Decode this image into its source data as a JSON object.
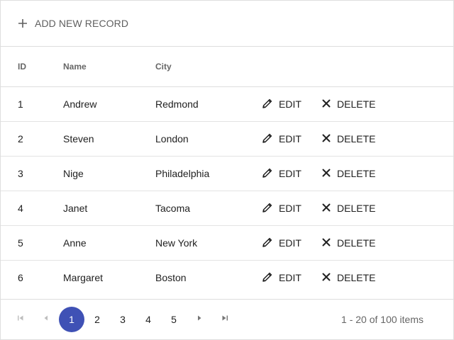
{
  "toolbar": {
    "add_icon": "plus-icon",
    "add_label": "ADD NEW RECORD"
  },
  "columns": [
    "ID",
    "Name",
    "City"
  ],
  "rows": [
    {
      "id": "1",
      "name": "Andrew",
      "city": "Redmond"
    },
    {
      "id": "2",
      "name": "Steven",
      "city": "London"
    },
    {
      "id": "3",
      "name": "Nige",
      "city": "Philadelphia"
    },
    {
      "id": "4",
      "name": "Janet",
      "city": "Tacoma"
    },
    {
      "id": "5",
      "name": "Anne",
      "city": "New York"
    },
    {
      "id": "6",
      "name": "Margaret",
      "city": "Boston"
    }
  ],
  "actions": {
    "edit_label": "EDIT",
    "edit_icon": "pencil-icon",
    "delete_label": "DELETE",
    "delete_icon": "close-icon"
  },
  "pager": {
    "pages": [
      "1",
      "2",
      "3",
      "4",
      "5"
    ],
    "current_page": "1",
    "info": "1 - 20 of 100 items",
    "accent": "#3f51b5"
  }
}
